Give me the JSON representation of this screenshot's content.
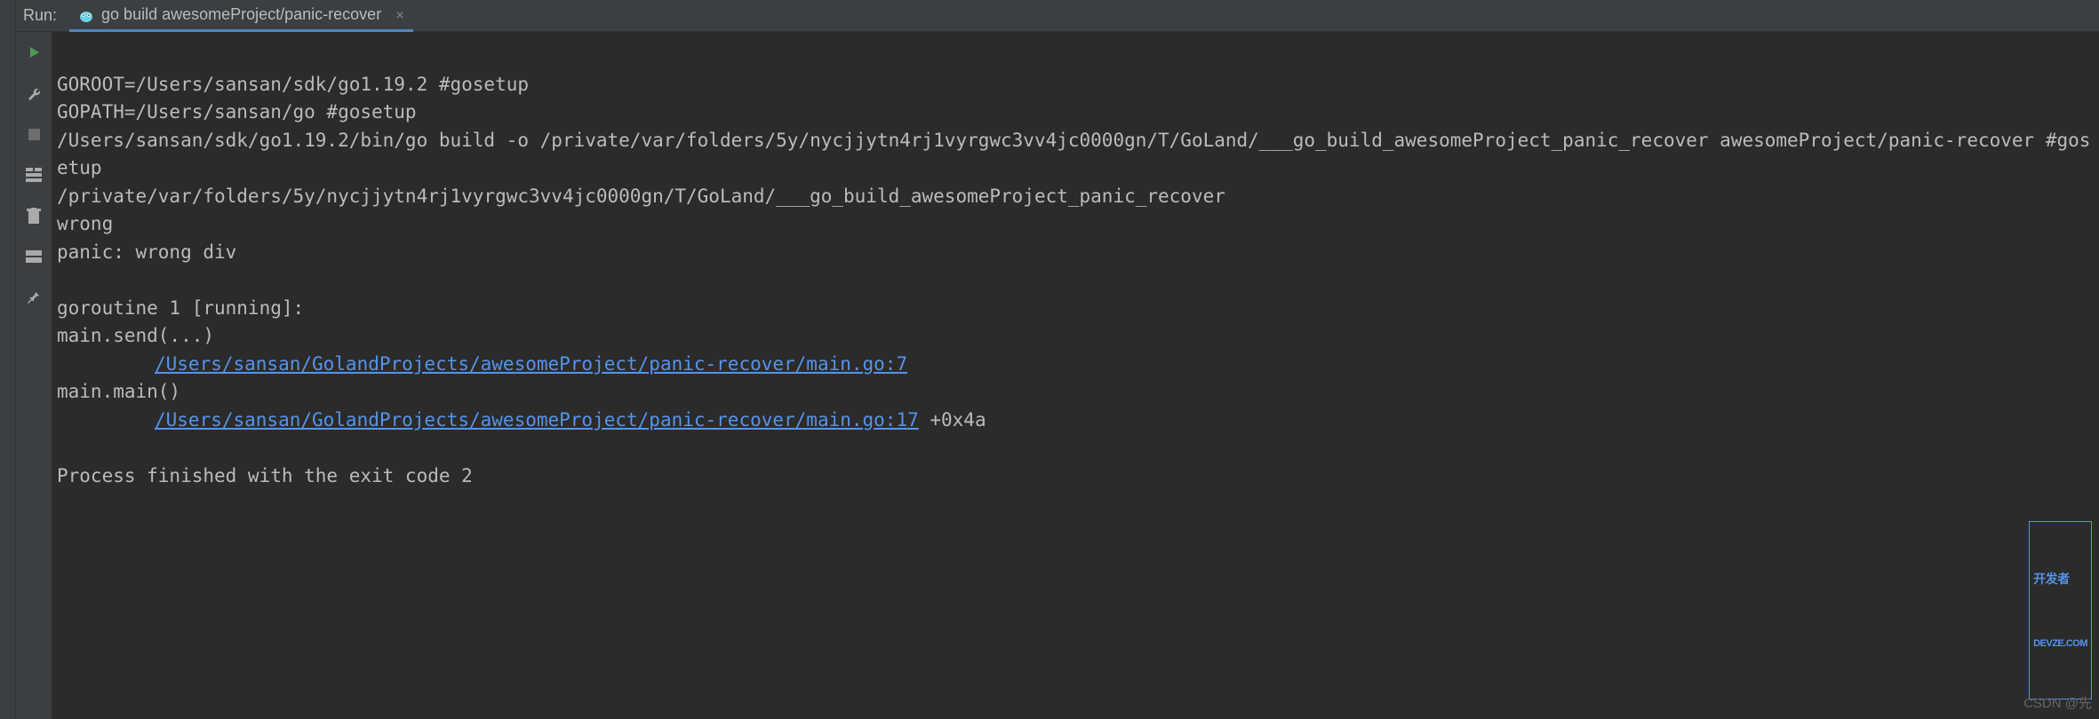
{
  "header": {
    "run_label": "Run:",
    "tab_label": "go build awesomeProject/panic-recover",
    "close_symbol": "×"
  },
  "console": {
    "line1": "GOROOT=/Users/sansan/sdk/go1.19.2 #gosetup",
    "line2": "GOPATH=/Users/sansan/go #gosetup",
    "line3": "/Users/sansan/sdk/go1.19.2/bin/go build -o /private/var/folders/5y/nycjjytn4rj1vyrgwc3vv4jc0000gn/T/GoLand/___go_build_awesomeProject_panic_recover awesomeProject/panic-recover #gosetup",
    "line4": "/private/var/folders/5y/nycjjytn4rj1vyrgwc3vv4jc0000gn/T/GoLand/___go_build_awesomeProject_panic_recover",
    "line5": "wrong",
    "line6": "panic: wrong div",
    "line7": "",
    "line8": "goroutine 1 [running]:",
    "line9": "main.send(...)",
    "link1": "/Users/sansan/GolandProjects/awesomeProject/panic-recover/main.go:7",
    "line11": "main.main()",
    "link2": "/Users/sansan/GolandProjects/awesomeProject/panic-recover/main.go:17",
    "line12_suffix": " +0x4a",
    "line13": "",
    "line14": "Process finished with the exit code 2"
  },
  "watermark": {
    "top": "开发者",
    "top2": "DEVZE.COM",
    "bottom": "CSDN @先"
  }
}
